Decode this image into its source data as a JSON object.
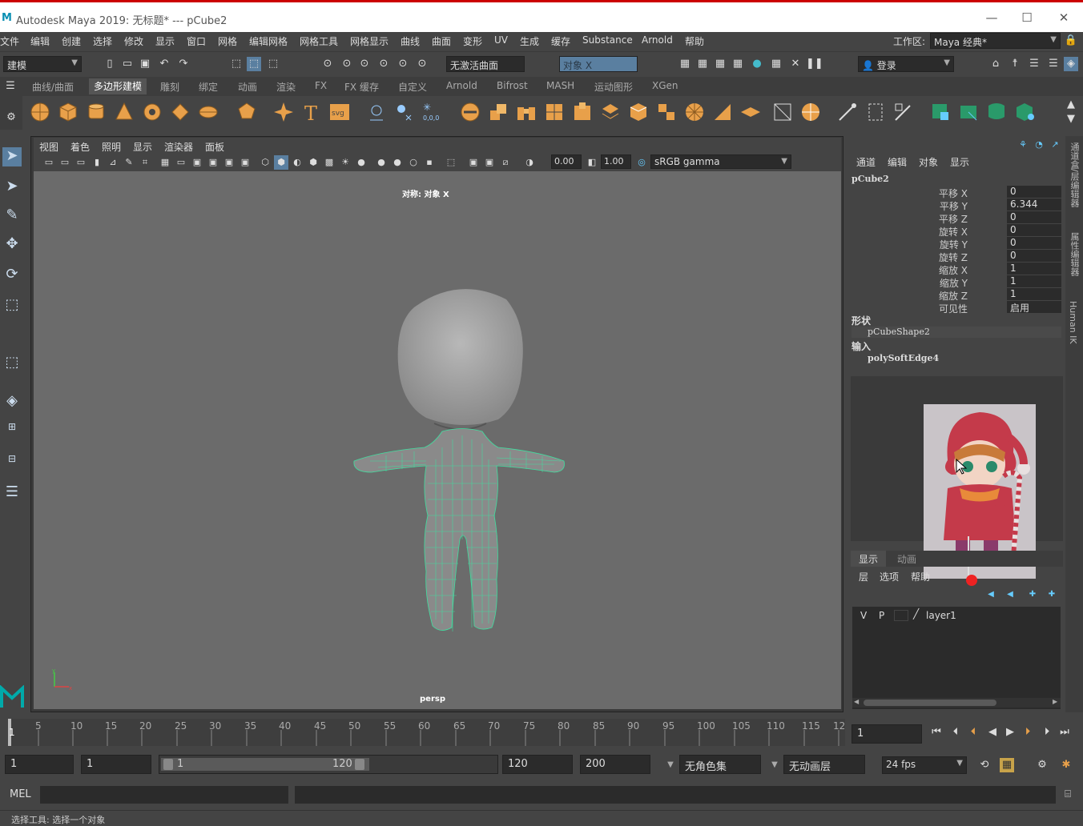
{
  "window": {
    "title": "Autodesk Maya 2019: 无标题*   ---   pCube2",
    "minimize": "—",
    "maximize": "☐",
    "close": "✕"
  },
  "menubar": {
    "items": [
      "文件",
      "编辑",
      "创建",
      "选择",
      "修改",
      "显示",
      "窗口",
      "网格",
      "编辑网格",
      "网格工具",
      "网格显示",
      "曲线",
      "曲面",
      "变形",
      "UV",
      "生成",
      "缓存",
      "Substance",
      "Arnold",
      "帮助"
    ],
    "workspace_label": "工作区:",
    "workspace_value": "Maya 经典*"
  },
  "toolbar1": {
    "mode_value": "建模",
    "live_surface": "无激活曲面",
    "symmetry_value": "对象 X",
    "login_label": "登录"
  },
  "shelf_tabs": [
    "曲线/曲面",
    "多边形建模",
    "雕刻",
    "绑定",
    "动画",
    "渲染",
    "FX",
    "FX 缓存",
    "自定义",
    "Arnold",
    "Bifrost",
    "MASH",
    "运动图形",
    "XGen"
  ],
  "viewport": {
    "menus": [
      "视图",
      "着色",
      "照明",
      "显示",
      "渲染器",
      "面板"
    ],
    "exposure": "0.00",
    "gamma": "1.00",
    "colorspace": "sRGB gamma",
    "symmetry_label": "对称: 对象 X",
    "camera_label": "persp"
  },
  "channelbox": {
    "menus": [
      "通道",
      "编辑",
      "对象",
      "显示"
    ],
    "object_name": "pCube2",
    "attributes": [
      {
        "label": "平移 X",
        "value": "0"
      },
      {
        "label": "平移 Y",
        "value": "6.344"
      },
      {
        "label": "平移 Z",
        "value": "0"
      },
      {
        "label": "旋转 X",
        "value": "0"
      },
      {
        "label": "旋转 Y",
        "value": "0"
      },
      {
        "label": "旋转 Z",
        "value": "0"
      },
      {
        "label": "缩放 X",
        "value": "1"
      },
      {
        "label": "缩放 Y",
        "value": "1"
      },
      {
        "label": "缩放 Z",
        "value": "1"
      },
      {
        "label": "可见性",
        "value": "启用"
      }
    ],
    "shapes_header": "形状",
    "shape_name": "pCubeShape2",
    "inputs_header": "输入",
    "input_name": "polySoftEdge4"
  },
  "layers": {
    "tabs": [
      "显示",
      "动画"
    ],
    "menus": [
      "层",
      "选项",
      "帮助"
    ],
    "layer_v": "V",
    "layer_p": "P",
    "layer_name": "layer1"
  },
  "side_tabs": [
    "通道盒/层编辑器",
    "属性编辑器",
    "Human IK"
  ],
  "timeline": {
    "ticks": [
      "1",
      "5",
      "10",
      "15",
      "20",
      "25",
      "30",
      "35",
      "40",
      "45",
      "50",
      "55",
      "60",
      "65",
      "70",
      "75",
      "80",
      "85",
      "90",
      "95",
      "100",
      "105",
      "110",
      "115",
      "12"
    ],
    "current_frame": "1"
  },
  "range": {
    "start": "1",
    "playback_start": "1",
    "slider_start": "1",
    "slider_end": "120",
    "playback_end": "120",
    "end": "200",
    "character_set": "无角色集",
    "anim_layer": "无动画层",
    "fps": "24 fps"
  },
  "command": {
    "label": "MEL"
  },
  "status": {
    "text": "选择工具: 选择一个对象"
  }
}
